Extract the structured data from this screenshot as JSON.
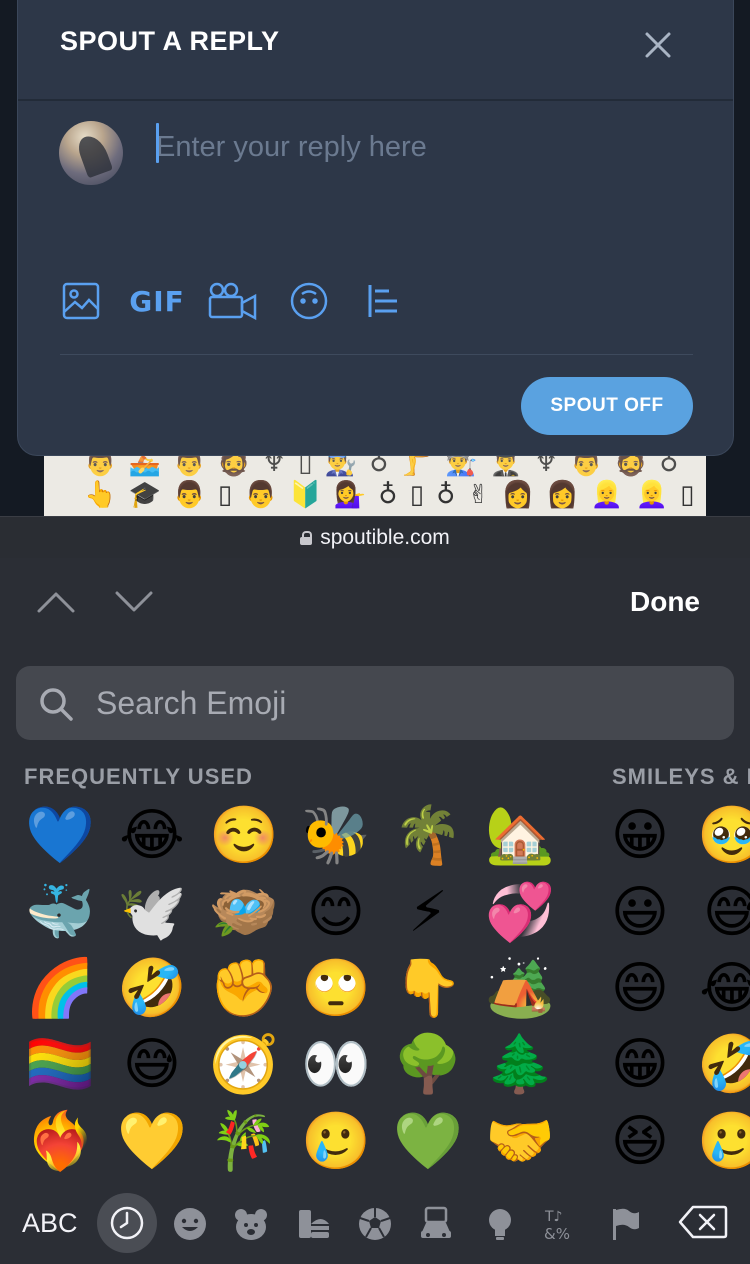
{
  "background_page": {
    "row1": "👨 🚣 👨 🧔 ♆ ▯ 👨‍🔧 ♁ 🦵 👨‍🏭 👨‍✈️ ♆ 👨 🧔 ♁",
    "row2": "👆 🎓 👨 ▯ 👨 🔰 💁‍♀️ ♁ ▯ ♁ ✌ 👩 👩 👱‍♀️ 👱‍♀️ ▯ 😴"
  },
  "modal": {
    "title": "SPOUT A REPLY",
    "close_icon": "close-icon",
    "avatar_icon": "user-avatar",
    "input_value": "",
    "input_placeholder": "Enter your reply here",
    "toolbar": {
      "image_icon": "image-icon",
      "gif_label": "GIF",
      "video_icon": "video-camera-icon",
      "emoji_icon": "emoji-face-icon",
      "poll_icon": "poll-icon"
    },
    "submit_label": "SPOUT OFF"
  },
  "browser": {
    "url": "spoutible.com",
    "lock_icon": "lock-icon"
  },
  "keyboard": {
    "done_label": "Done",
    "search_placeholder": "Search Emoji",
    "section_frequent": "FREQUENTLY USED",
    "section_smileys": "SMILEYS & P",
    "frequent_columns": [
      [
        "💙",
        "🐳",
        "🌈",
        "🏳️‍🌈",
        "❤️‍🔥"
      ],
      [
        "😂",
        "🕊️",
        "🤣",
        "😅",
        "💛"
      ],
      [
        "☺️",
        "🪺",
        "✊",
        "🧭",
        "🎋"
      ],
      [
        "🐝",
        "😊",
        "🙄",
        "👀",
        "🥲"
      ],
      [
        "🌴",
        "⚡",
        "👇",
        "🌳",
        "💚"
      ],
      [
        "🏡",
        "💞",
        "🏕️",
        "🌲",
        "🤝"
      ]
    ],
    "smiley_columns": [
      [
        "😀",
        "😃",
        "😄",
        "😁",
        "😆"
      ],
      [
        "🥹",
        "😅",
        "😂",
        "🤣",
        "🥲"
      ]
    ],
    "abc_label": "ABC",
    "category_icons": [
      "clock-icon",
      "smiley-icon",
      "bear-icon",
      "food-icon",
      "ball-icon",
      "car-icon",
      "lightbulb-icon",
      "symbols-icon",
      "flag-icon"
    ],
    "backspace_icon": "backspace-icon"
  }
}
